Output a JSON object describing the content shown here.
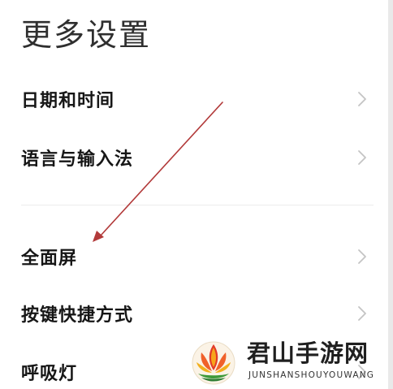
{
  "page": {
    "title": "更多设置"
  },
  "menu": {
    "items": [
      {
        "label": "日期和时间",
        "icon": "chevron-right-icon"
      },
      {
        "label": "语言与输入法",
        "icon": "chevron-right-icon"
      },
      {
        "label": "全面屏",
        "icon": "chevron-right-icon"
      },
      {
        "label": "按键快捷方式",
        "icon": "chevron-right-icon"
      },
      {
        "label": "呼吸灯",
        "icon": "chevron-right-icon"
      }
    ]
  },
  "watermark": {
    "title": "君山手游网",
    "subtitle": "JUNSHANSHOUYOUWANG"
  },
  "colors": {
    "background": "#ffffff",
    "text_primary": "#161616",
    "title": "#2f2f2f",
    "chevron": "#c4c4c4",
    "divider": "#ececec",
    "annotation_arrow": "#b23a3a"
  }
}
